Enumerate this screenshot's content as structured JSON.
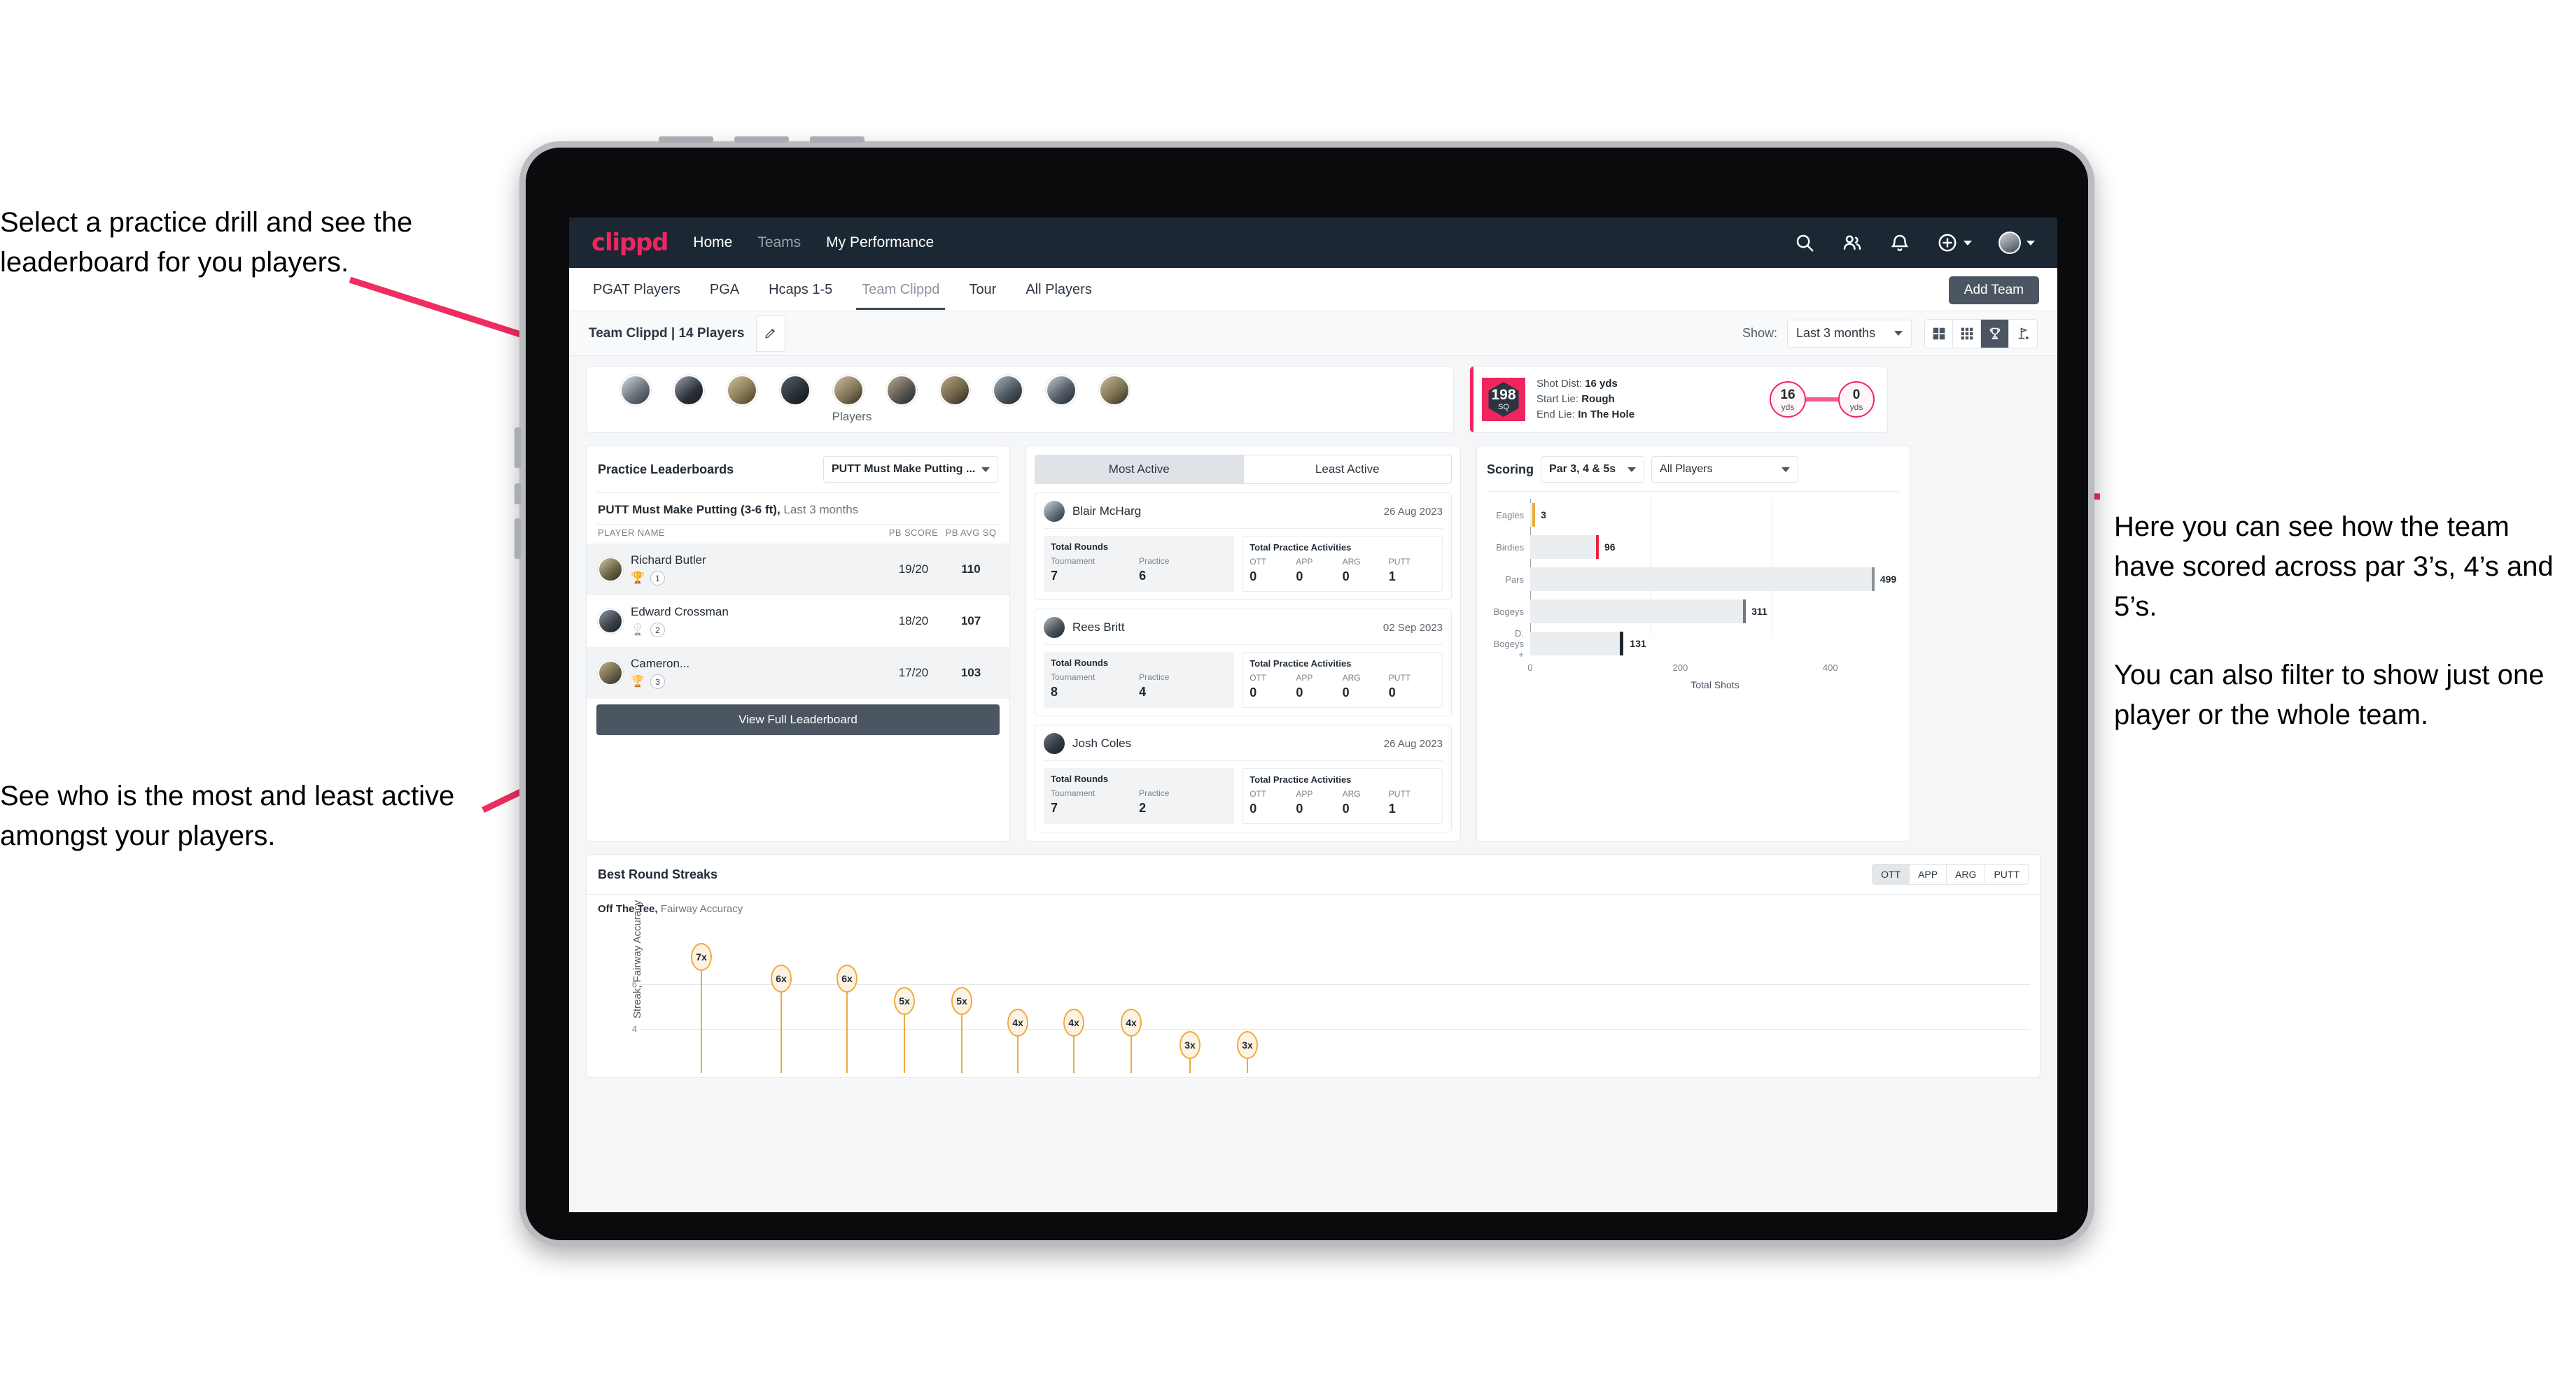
{
  "annotations": {
    "practice": [
      "Select a practice drill and see the leaderboard for you players."
    ],
    "active": [
      "See who is the most and least active amongst your players."
    ],
    "scoring": [
      "Here you can see how the team have scored across par 3’s, 4’s and 5’s.",
      "You can also filter to show just one player or the whole team."
    ]
  },
  "colors": {
    "brand": "#f0255f",
    "navbar": "#1b2733",
    "dark_button": "#4c5662",
    "streak_accent": "#eeab3c",
    "bar_grey": "#ebeef0"
  },
  "topnav": {
    "logo": "clippd",
    "links": [
      {
        "label": "Home",
        "active": true
      },
      {
        "label": "Teams",
        "active": false
      },
      {
        "label": "My Performance",
        "active": true
      }
    ],
    "icons": [
      "search-icon",
      "people-icon",
      "bell-icon",
      "plus-circle-icon",
      "avatar"
    ]
  },
  "subnav": {
    "tabs": [
      {
        "label": "PGAT Players",
        "active": false
      },
      {
        "label": "PGA",
        "active": false
      },
      {
        "label": "Hcaps 1-5",
        "active": false
      },
      {
        "label": "Team Clippd",
        "active": true
      },
      {
        "label": "Tour",
        "active": false
      },
      {
        "label": "All Players",
        "active": false
      }
    ],
    "add_team_label": "Add Team"
  },
  "toolbar": {
    "team_label": "Team Clippd | 14 Players",
    "edit_icon": "pencil-icon",
    "show_label": "Show:",
    "range_value": "Last 3 months",
    "view_modes": [
      {
        "icon": "grid-2x2-icon",
        "active": false
      },
      {
        "icon": "grid-3x3-icon",
        "active": false
      },
      {
        "icon": "trophy-icon",
        "active": true
      },
      {
        "icon": "golf-flag-icon",
        "active": false
      }
    ]
  },
  "players_strip": {
    "label": "Players",
    "count": 10
  },
  "shot_card": {
    "sq_value": "198",
    "sq_unit": "SQ",
    "lines": [
      {
        "label": "Shot Dist:",
        "value": "16 yds"
      },
      {
        "label": "Start Lie:",
        "value": "Rough"
      },
      {
        "label": "End Lie:",
        "value": "In The Hole"
      }
    ],
    "start_yds": "16",
    "end_yds": "0",
    "unit": "yds"
  },
  "leaderboard": {
    "title": "Practice Leaderboards",
    "drill_select": "PUTT Must Make Putting ...",
    "drill_name": "PUTT Must Make Putting (3-6 ft),",
    "drill_period": "Last 3 months",
    "columns": [
      "PLAYER NAME",
      "PB SCORE",
      "PB AVG SQ"
    ],
    "rows": [
      {
        "name": "Richard Butler",
        "rank": "1",
        "trophy": "gold",
        "pb_score": "19/20",
        "pb_avg_sq": "110"
      },
      {
        "name": "Edward Crossman",
        "rank": "2",
        "trophy": "silver",
        "pb_score": "18/20",
        "pb_avg_sq": "107"
      },
      {
        "name": "Cameron...",
        "rank": "3",
        "trophy": "bronze",
        "pb_score": "17/20",
        "pb_avg_sq": "103"
      }
    ],
    "view_full_label": "View Full Leaderboard"
  },
  "activity": {
    "tabs": [
      {
        "label": "Most Active",
        "active": true
      },
      {
        "label": "Least Active",
        "active": false
      }
    ],
    "rounds_title": "Total Rounds",
    "rounds_cols": [
      "Tournament",
      "Practice"
    ],
    "practice_title": "Total Practice Activities",
    "practice_cols": [
      "OTT",
      "APP",
      "ARG",
      "PUTT"
    ],
    "cards": [
      {
        "name": "Blair McHarg",
        "date": "26 Aug 2023",
        "tournament": "7",
        "practice": "6",
        "ott": "0",
        "app": "0",
        "arg": "0",
        "putt": "1"
      },
      {
        "name": "Rees Britt",
        "date": "02 Sep 2023",
        "tournament": "8",
        "practice": "4",
        "ott": "0",
        "app": "0",
        "arg": "0",
        "putt": "0"
      },
      {
        "name": "Josh Coles",
        "date": "26 Aug 2023",
        "tournament": "7",
        "practice": "2",
        "ott": "0",
        "app": "0",
        "arg": "0",
        "putt": "1"
      }
    ]
  },
  "scoring": {
    "title": "Scoring",
    "par_select": "Par 3, 4 & 5s",
    "players_select": "All Players"
  },
  "streaks": {
    "title": "Best Round Streaks",
    "tabs": [
      {
        "label": "OTT",
        "active": true
      },
      {
        "label": "APP",
        "active": false
      },
      {
        "label": "ARG",
        "active": false
      },
      {
        "label": "PUTT",
        "active": false
      }
    ],
    "subtitle_bold": "Off The Tee,",
    "subtitle_rest": "Fairway Accuracy"
  },
  "chart_data": [
    {
      "type": "bar",
      "orientation": "horizontal",
      "title": "Scoring",
      "categories": [
        "Eagles",
        "Birdies",
        "Pars",
        "Bogeys",
        "D. Bogeys +"
      ],
      "values": [
        3,
        96,
        499,
        311,
        131
      ],
      "cap_colors": [
        "#eeab3c",
        "#e8203f",
        "#8a939b",
        "#6e7782",
        "#1f2830"
      ],
      "xlabel": "Total Shots",
      "ylabel": "",
      "xlim": [
        0,
        540
      ],
      "xticks": [
        0,
        200,
        400
      ],
      "grid": true,
      "legend": "none"
    },
    {
      "type": "bar",
      "orientation": "vertical-lollipop",
      "title": "Best Round Streaks",
      "subtitle": "Off The Tee, Fairway Accuracy",
      "ylabel": "Streak, Fairway Accuracy",
      "categories": [
        "",
        "",
        "",
        "",
        "",
        "",
        "",
        "",
        "",
        ""
      ],
      "labels": [
        "7x",
        "6x",
        "6x",
        "5x",
        "5x",
        "4x",
        "4x",
        "4x",
        "3x",
        "3x"
      ],
      "values": [
        7,
        6,
        6,
        5,
        5,
        4,
        4,
        4,
        3,
        3
      ],
      "ylim": [
        0,
        7.6
      ],
      "yticks": [
        4,
        6
      ],
      "grid": true,
      "legend": "none"
    }
  ]
}
